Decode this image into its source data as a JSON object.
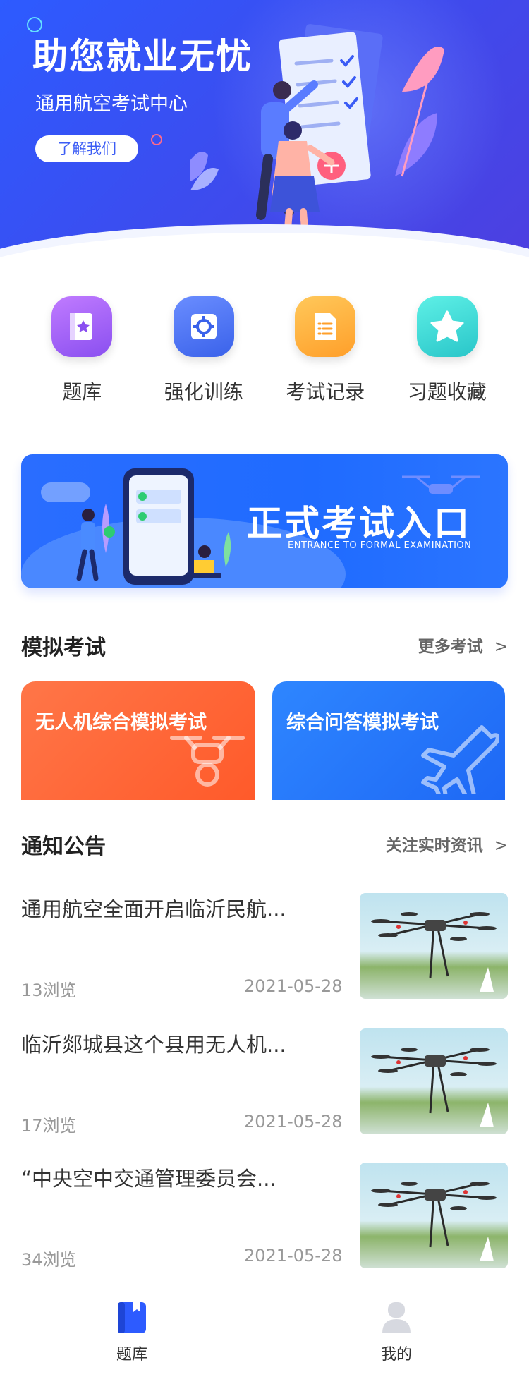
{
  "hero": {
    "title": "助您就业无忧",
    "subtitle": "通用航空考试中心",
    "about_button": "了解我们"
  },
  "features": [
    {
      "label": "题库",
      "icon": "book-star-icon"
    },
    {
      "label": "强化训练",
      "icon": "target-icon"
    },
    {
      "label": "考试记录",
      "icon": "document-list-icon"
    },
    {
      "label": "习题收藏",
      "icon": "star-icon"
    }
  ],
  "entrance": {
    "title": "正式考试入口",
    "subtitle": "ENTRANCE TO FORMAL EXAMINATION"
  },
  "mock_section": {
    "title": "模拟考试",
    "more": "更多考试",
    "cards": [
      {
        "label": "无人机综合模拟考试",
        "color": "#ff5f30"
      },
      {
        "label": "综合问答模拟考试",
        "color": "#2479fb"
      }
    ]
  },
  "notice_section": {
    "title": "通知公告",
    "more": "关注实时资讯"
  },
  "news": [
    {
      "title": "通用航空全面开启临沂民航...",
      "views": "13浏览",
      "date": "2021-05-28"
    },
    {
      "title": "临沂郯城县这个县用无人机...",
      "views": "17浏览",
      "date": "2021-05-28"
    },
    {
      "title": "“中央空中交通管理委员会...",
      "views": "34浏览",
      "date": "2021-05-28"
    }
  ],
  "tabbar": {
    "tabs": [
      {
        "label": "题库",
        "icon": "question-bank-icon",
        "active": true
      },
      {
        "label": "我的",
        "icon": "profile-icon",
        "active": false
      }
    ]
  },
  "colors": {
    "primary": "#2d5bff",
    "orange": "#ff5f30",
    "blue": "#2479fb"
  }
}
